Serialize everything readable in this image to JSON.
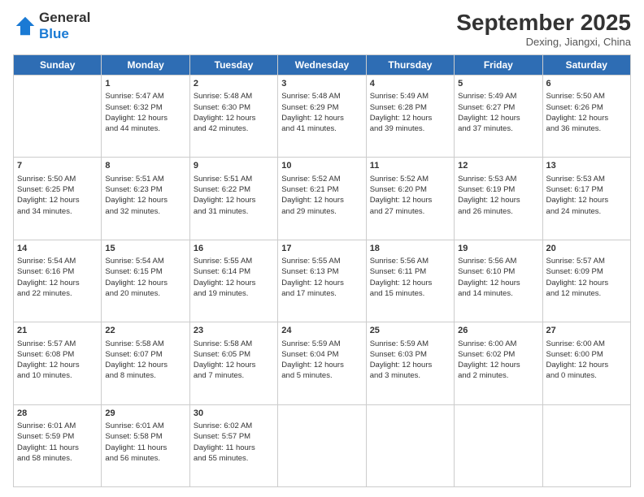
{
  "header": {
    "logo_line1": "General",
    "logo_line2": "Blue",
    "month": "September 2025",
    "location": "Dexing, Jiangxi, China"
  },
  "weekdays": [
    "Sunday",
    "Monday",
    "Tuesday",
    "Wednesday",
    "Thursday",
    "Friday",
    "Saturday"
  ],
  "weeks": [
    [
      {
        "day": "",
        "info": ""
      },
      {
        "day": "1",
        "info": "Sunrise: 5:47 AM\nSunset: 6:32 PM\nDaylight: 12 hours\nand 44 minutes."
      },
      {
        "day": "2",
        "info": "Sunrise: 5:48 AM\nSunset: 6:30 PM\nDaylight: 12 hours\nand 42 minutes."
      },
      {
        "day": "3",
        "info": "Sunrise: 5:48 AM\nSunset: 6:29 PM\nDaylight: 12 hours\nand 41 minutes."
      },
      {
        "day": "4",
        "info": "Sunrise: 5:49 AM\nSunset: 6:28 PM\nDaylight: 12 hours\nand 39 minutes."
      },
      {
        "day": "5",
        "info": "Sunrise: 5:49 AM\nSunset: 6:27 PM\nDaylight: 12 hours\nand 37 minutes."
      },
      {
        "day": "6",
        "info": "Sunrise: 5:50 AM\nSunset: 6:26 PM\nDaylight: 12 hours\nand 36 minutes."
      }
    ],
    [
      {
        "day": "7",
        "info": "Sunrise: 5:50 AM\nSunset: 6:25 PM\nDaylight: 12 hours\nand 34 minutes."
      },
      {
        "day": "8",
        "info": "Sunrise: 5:51 AM\nSunset: 6:23 PM\nDaylight: 12 hours\nand 32 minutes."
      },
      {
        "day": "9",
        "info": "Sunrise: 5:51 AM\nSunset: 6:22 PM\nDaylight: 12 hours\nand 31 minutes."
      },
      {
        "day": "10",
        "info": "Sunrise: 5:52 AM\nSunset: 6:21 PM\nDaylight: 12 hours\nand 29 minutes."
      },
      {
        "day": "11",
        "info": "Sunrise: 5:52 AM\nSunset: 6:20 PM\nDaylight: 12 hours\nand 27 minutes."
      },
      {
        "day": "12",
        "info": "Sunrise: 5:53 AM\nSunset: 6:19 PM\nDaylight: 12 hours\nand 26 minutes."
      },
      {
        "day": "13",
        "info": "Sunrise: 5:53 AM\nSunset: 6:17 PM\nDaylight: 12 hours\nand 24 minutes."
      }
    ],
    [
      {
        "day": "14",
        "info": "Sunrise: 5:54 AM\nSunset: 6:16 PM\nDaylight: 12 hours\nand 22 minutes."
      },
      {
        "day": "15",
        "info": "Sunrise: 5:54 AM\nSunset: 6:15 PM\nDaylight: 12 hours\nand 20 minutes."
      },
      {
        "day": "16",
        "info": "Sunrise: 5:55 AM\nSunset: 6:14 PM\nDaylight: 12 hours\nand 19 minutes."
      },
      {
        "day": "17",
        "info": "Sunrise: 5:55 AM\nSunset: 6:13 PM\nDaylight: 12 hours\nand 17 minutes."
      },
      {
        "day": "18",
        "info": "Sunrise: 5:56 AM\nSunset: 6:11 PM\nDaylight: 12 hours\nand 15 minutes."
      },
      {
        "day": "19",
        "info": "Sunrise: 5:56 AM\nSunset: 6:10 PM\nDaylight: 12 hours\nand 14 minutes."
      },
      {
        "day": "20",
        "info": "Sunrise: 5:57 AM\nSunset: 6:09 PM\nDaylight: 12 hours\nand 12 minutes."
      }
    ],
    [
      {
        "day": "21",
        "info": "Sunrise: 5:57 AM\nSunset: 6:08 PM\nDaylight: 12 hours\nand 10 minutes."
      },
      {
        "day": "22",
        "info": "Sunrise: 5:58 AM\nSunset: 6:07 PM\nDaylight: 12 hours\nand 8 minutes."
      },
      {
        "day": "23",
        "info": "Sunrise: 5:58 AM\nSunset: 6:05 PM\nDaylight: 12 hours\nand 7 minutes."
      },
      {
        "day": "24",
        "info": "Sunrise: 5:59 AM\nSunset: 6:04 PM\nDaylight: 12 hours\nand 5 minutes."
      },
      {
        "day": "25",
        "info": "Sunrise: 5:59 AM\nSunset: 6:03 PM\nDaylight: 12 hours\nand 3 minutes."
      },
      {
        "day": "26",
        "info": "Sunrise: 6:00 AM\nSunset: 6:02 PM\nDaylight: 12 hours\nand 2 minutes."
      },
      {
        "day": "27",
        "info": "Sunrise: 6:00 AM\nSunset: 6:00 PM\nDaylight: 12 hours\nand 0 minutes."
      }
    ],
    [
      {
        "day": "28",
        "info": "Sunrise: 6:01 AM\nSunset: 5:59 PM\nDaylight: 11 hours\nand 58 minutes."
      },
      {
        "day": "29",
        "info": "Sunrise: 6:01 AM\nSunset: 5:58 PM\nDaylight: 11 hours\nand 56 minutes."
      },
      {
        "day": "30",
        "info": "Sunrise: 6:02 AM\nSunset: 5:57 PM\nDaylight: 11 hours\nand 55 minutes."
      },
      {
        "day": "",
        "info": ""
      },
      {
        "day": "",
        "info": ""
      },
      {
        "day": "",
        "info": ""
      },
      {
        "day": "",
        "info": ""
      }
    ]
  ]
}
